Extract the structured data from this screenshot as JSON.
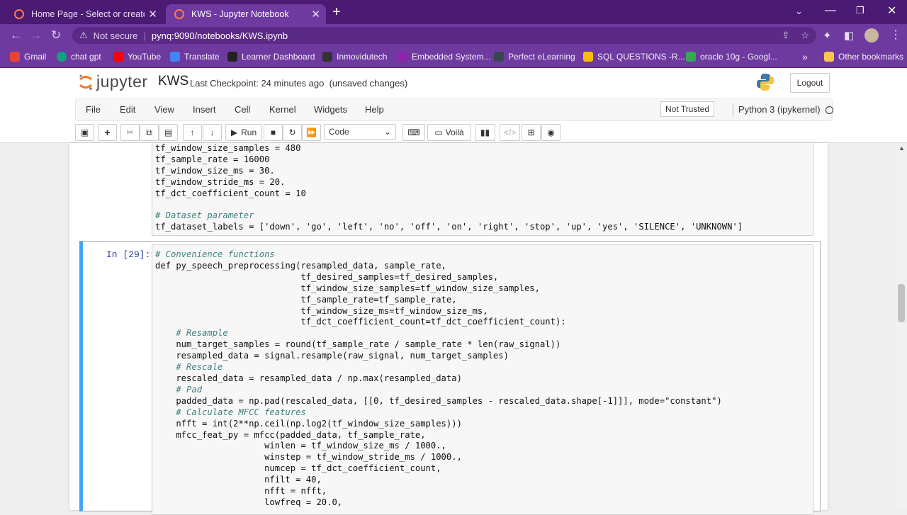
{
  "browser": {
    "tabs": [
      {
        "title": "Home Page - Select or create a n",
        "active": false
      },
      {
        "title": "KWS - Jupyter Notebook",
        "active": true
      }
    ],
    "new_tab": "+",
    "url_warning": "Not secure",
    "url": "pynq:9090/notebooks/KWS.ipynb",
    "bookmarks": [
      {
        "label": "Gmail",
        "color": "#ea4335"
      },
      {
        "label": "chat gpt",
        "color": "#10a37f"
      },
      {
        "label": "YouTube",
        "color": "#ff0000"
      },
      {
        "label": "Translate",
        "color": "#4285f4"
      },
      {
        "label": "Learner Dashboard",
        "color": "#222222"
      },
      {
        "label": "Inmovidutech",
        "color": "#333333"
      },
      {
        "label": "Embedded System...",
        "color": "#8e24aa"
      },
      {
        "label": "Perfect eLearning",
        "color": "#37474f"
      },
      {
        "label": "SQL QUESTIONS -R...",
        "color": "#fbbc04"
      },
      {
        "label": "oracle 10g - Googl...",
        "color": "#34a853"
      }
    ],
    "more_bookmarks": "»",
    "other_bookmarks": "Other bookmarks"
  },
  "jupyter": {
    "logo": "jupyter",
    "notebook_name": "KWS",
    "checkpoint": "Last Checkpoint: 24 minutes ago",
    "unsaved": "(unsaved changes)",
    "logout": "Logout",
    "menus": [
      "File",
      "Edit",
      "View",
      "Insert",
      "Cell",
      "Kernel",
      "Widgets",
      "Help"
    ],
    "trust": "Not Trusted",
    "kernel": "Python 3 (ipykernel)",
    "toolbar": {
      "run": "Run",
      "cell_type": "Code",
      "voila": "Voilà"
    }
  },
  "cells": {
    "cell1_lines": [
      "tf_window_size_samples = 480",
      "tf_sample_rate = 16000",
      "tf_window_size_ms = 30.",
      "tf_window_stride_ms = 20.",
      "tf_dct_coefficient_count = 10",
      "",
      "# Dataset parameter",
      "tf_dataset_labels = ['down', 'go', 'left', 'no', 'off', 'on', 'right', 'stop', 'up', 'yes', 'SILENCE', 'UNKNOWN']"
    ],
    "cell2_prompt": "In [29]:",
    "cell2_lines": [
      "# Convenience functions",
      "def py_speech_preprocessing(resampled_data, sample_rate,",
      "                            tf_desired_samples=tf_desired_samples,",
      "                            tf_window_size_samples=tf_window_size_samples,",
      "                            tf_sample_rate=tf_sample_rate,",
      "                            tf_window_size_ms=tf_window_size_ms,",
      "                            tf_dct_coefficient_count=tf_dct_coefficient_count):",
      "    # Resample",
      "    num_target_samples = round(tf_sample_rate / sample_rate * len(raw_signal))",
      "    resampled_data = signal.resample(raw_signal, num_target_samples)",
      "    # Rescale",
      "    rescaled_data = resampled_data / np.max(resampled_data)",
      "    # Pad",
      "    padded_data = np.pad(rescaled_data, [[0, tf_desired_samples - rescaled_data.shape[-1]]], mode=\"constant\")",
      "    # Calculate MFCC features",
      "    nfft = int(2**np.ceil(np.log2(tf_window_size_samples)))",
      "    mfcc_feat_py = mfcc(padded_data, tf_sample_rate,",
      "                     winlen = tf_window_size_ms / 1000.,",
      "                     winstep = tf_window_stride_ms / 1000.,",
      "                     numcep = tf_dct_coefficient_count,",
      "                     nfilt = 40,",
      "                     nfft = nfft,",
      "                     lowfreq = 20.0,"
    ]
  }
}
